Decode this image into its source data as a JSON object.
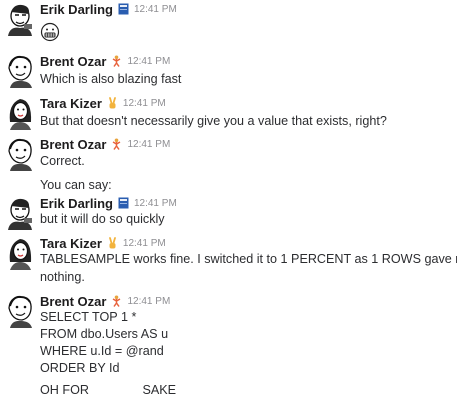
{
  "messages": [
    {
      "author": "Erik Darling",
      "status_icon": "blue-book-emoji",
      "time": "12:41 PM",
      "avatar": "erik-avatar",
      "lines": [],
      "emoji": "grimacing-face-emoji"
    },
    {
      "author": "Brent Ozar",
      "status_icon": "stretching-person-emoji",
      "time": "12:41 PM",
      "avatar": "brent-avatar",
      "lines": [
        "Which is also blazing fast"
      ]
    },
    {
      "author": "Tara Kizer",
      "status_icon": "victory-hand-emoji",
      "time": "12:41 PM",
      "avatar": "tara-avatar",
      "lines": [
        "But that doesn't necessarily give you a value that exists, right?"
      ]
    },
    {
      "author": "Brent Ozar",
      "status_icon": "stretching-person-emoji",
      "time": "12:41 PM",
      "avatar": "brent-avatar",
      "lines": [
        "Correct.",
        "You can say:"
      ]
    },
    {
      "author": "Erik Darling",
      "status_icon": "blue-book-emoji",
      "time": "12:41 PM",
      "avatar": "erik-avatar",
      "lines": [
        "but it will do so quickly"
      ]
    },
    {
      "author": "Tara Kizer",
      "status_icon": "victory-hand-emoji",
      "time": "12:41 PM",
      "avatar": "tara-avatar",
      "lines": [
        "TABLESAMPLE works fine. I switched it to 1 PERCENT as 1 ROWS gave me",
        "nothing."
      ]
    },
    {
      "author": "Brent Ozar",
      "status_icon": "stretching-person-emoji",
      "time": "12:41 PM",
      "avatar": "brent-avatar",
      "lines": [
        "SELECT TOP 1 *",
        "FROM dbo.Users AS u",
        "WHERE u.Id = @rand",
        "ORDER BY Id"
      ],
      "last_line": {
        "part1": "OH FOR",
        "part2": "SAKE"
      }
    }
  ],
  "colors": {
    "name": "#1d1c1d",
    "text": "#2c2d30",
    "time": "#8e8e92"
  }
}
